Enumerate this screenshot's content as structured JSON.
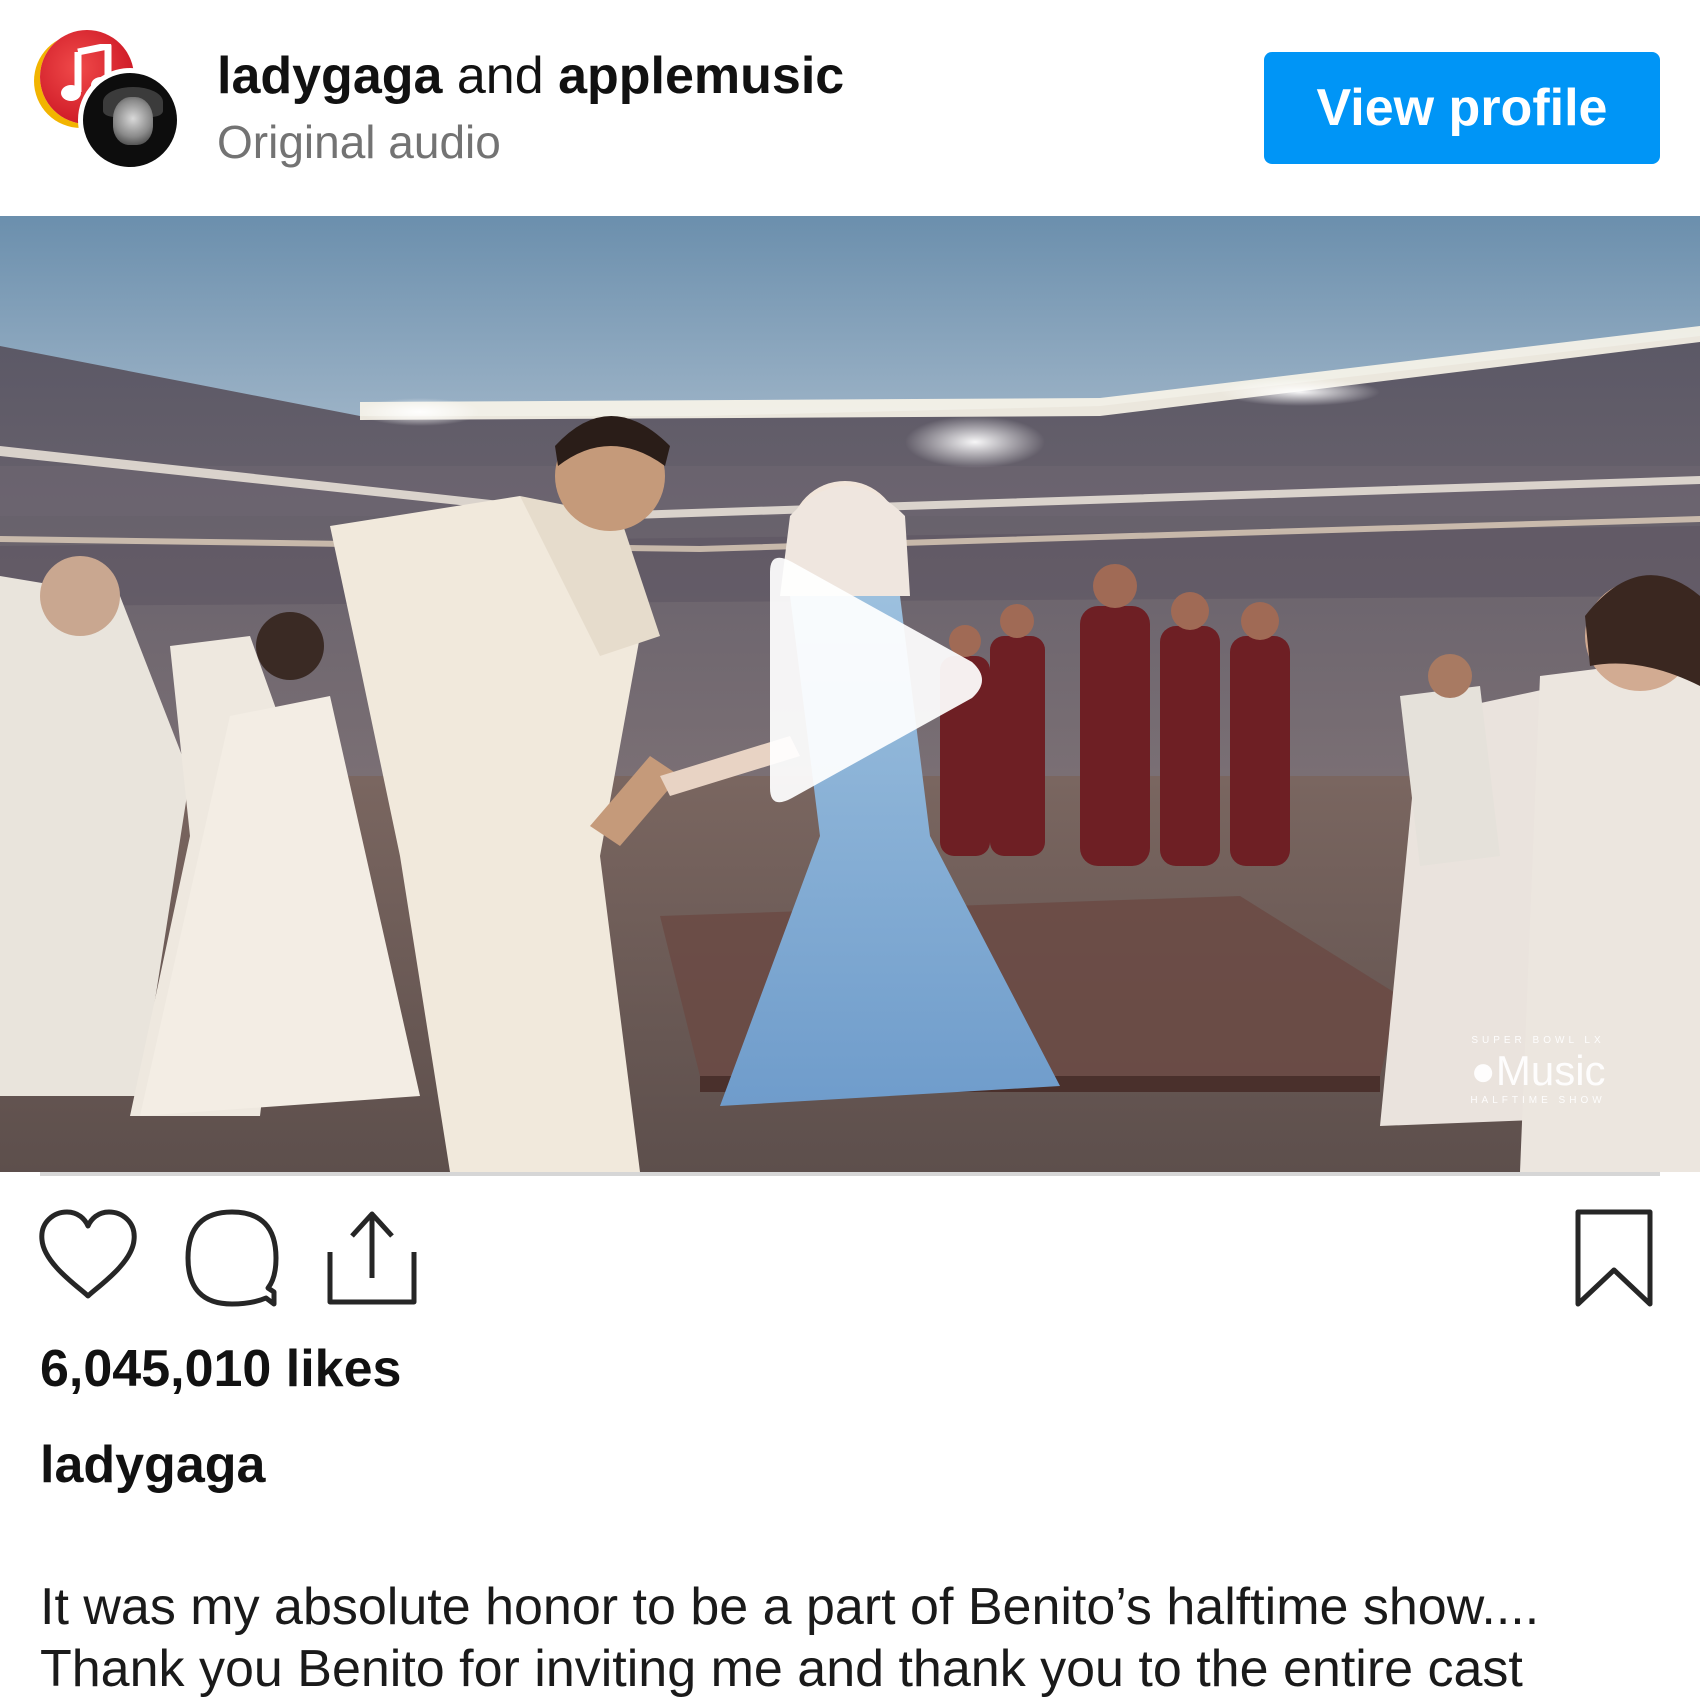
{
  "header": {
    "owner_primary": "ladygaga",
    "conjunction": " and ",
    "owner_secondary": "applemusic",
    "audio_label": "Original audio",
    "view_profile_label": "View profile"
  },
  "video": {
    "watermark_top": "SUPER BOWL LX",
    "watermark_brand": "Music",
    "watermark_bottom": "HALFTIME SHOW"
  },
  "actions": {
    "like_icon": "heart-icon",
    "comment_icon": "comment-bubble-icon",
    "share_icon": "share-upload-icon",
    "save_icon": "bookmark-icon"
  },
  "post": {
    "likes": "6,045,010 likes",
    "caption_author": "ladygaga",
    "caption_lines": [
      "It was my absolute honor to be a part of Benito’s halftime show....",
      "Thank you Benito for inviting me and thank you to the entire cast"
    ]
  },
  "colors": {
    "primary_button": "#0095f6",
    "secondary_text": "#737373",
    "text": "#111111"
  }
}
